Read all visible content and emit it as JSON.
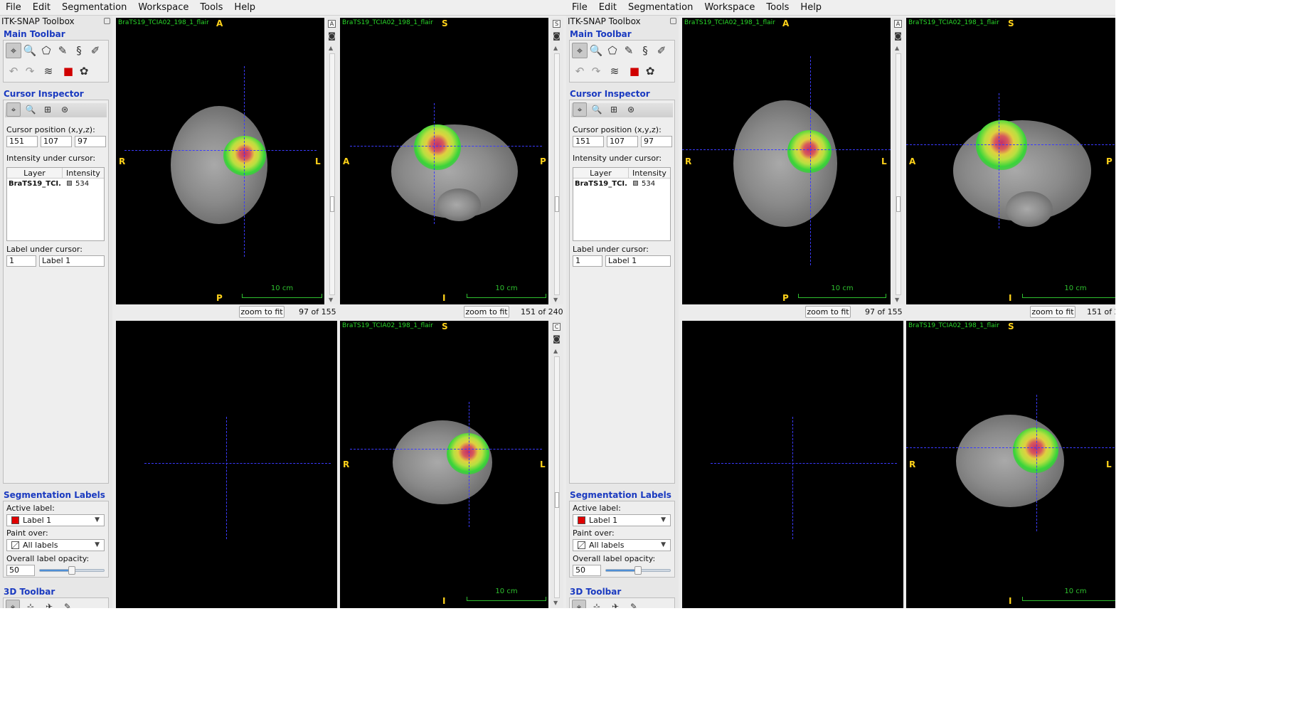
{
  "menu": [
    "File",
    "Edit",
    "Segmentation",
    "Workspace",
    "Tools",
    "Help"
  ],
  "toolbox": {
    "title": "ITK-SNAP Toolbox",
    "main_toolbar_label": "Main Toolbar",
    "cursor_inspector_label": "Cursor Inspector",
    "cursor_position_label": "Cursor position (x,y,z):",
    "cursor_x": "151",
    "cursor_y": "107",
    "cursor_z": "97",
    "intensity_label": "Intensity under cursor:",
    "table_headers": [
      "Layer",
      "Intensity"
    ],
    "layer_name": "BraTS19_TCI...",
    "intensity_value": "534",
    "label_under_cursor_label": "Label under cursor:",
    "label_id": "1",
    "label_name": "Label 1",
    "seg_labels_label": "Segmentation Labels",
    "active_label_label": "Active label:",
    "active_label_value": "Label 1",
    "active_label_color": "#e00000",
    "paint_over_label": "Paint over:",
    "paint_over_value": "All labels",
    "opacity_label": "Overall label opacity:",
    "opacity_value": "50",
    "opacity_fraction": 0.5,
    "toolbar3d_label": "3D Toolbar"
  },
  "views": {
    "image_name": "BraTS19_TCIA02_198_1_flair",
    "axial": {
      "top": "A",
      "left": "R",
      "right": "L",
      "bottom": "P",
      "slice": "97 of 155"
    },
    "sagittal": {
      "top": "S",
      "left": "A",
      "right": "P",
      "bottom": "I",
      "slice": "151 of 240"
    },
    "coronal": {
      "top": "S",
      "left": "R",
      "right": "L",
      "bottom": "I"
    },
    "scale_label": "10 cm",
    "zoom_label": "zoom to fit"
  }
}
